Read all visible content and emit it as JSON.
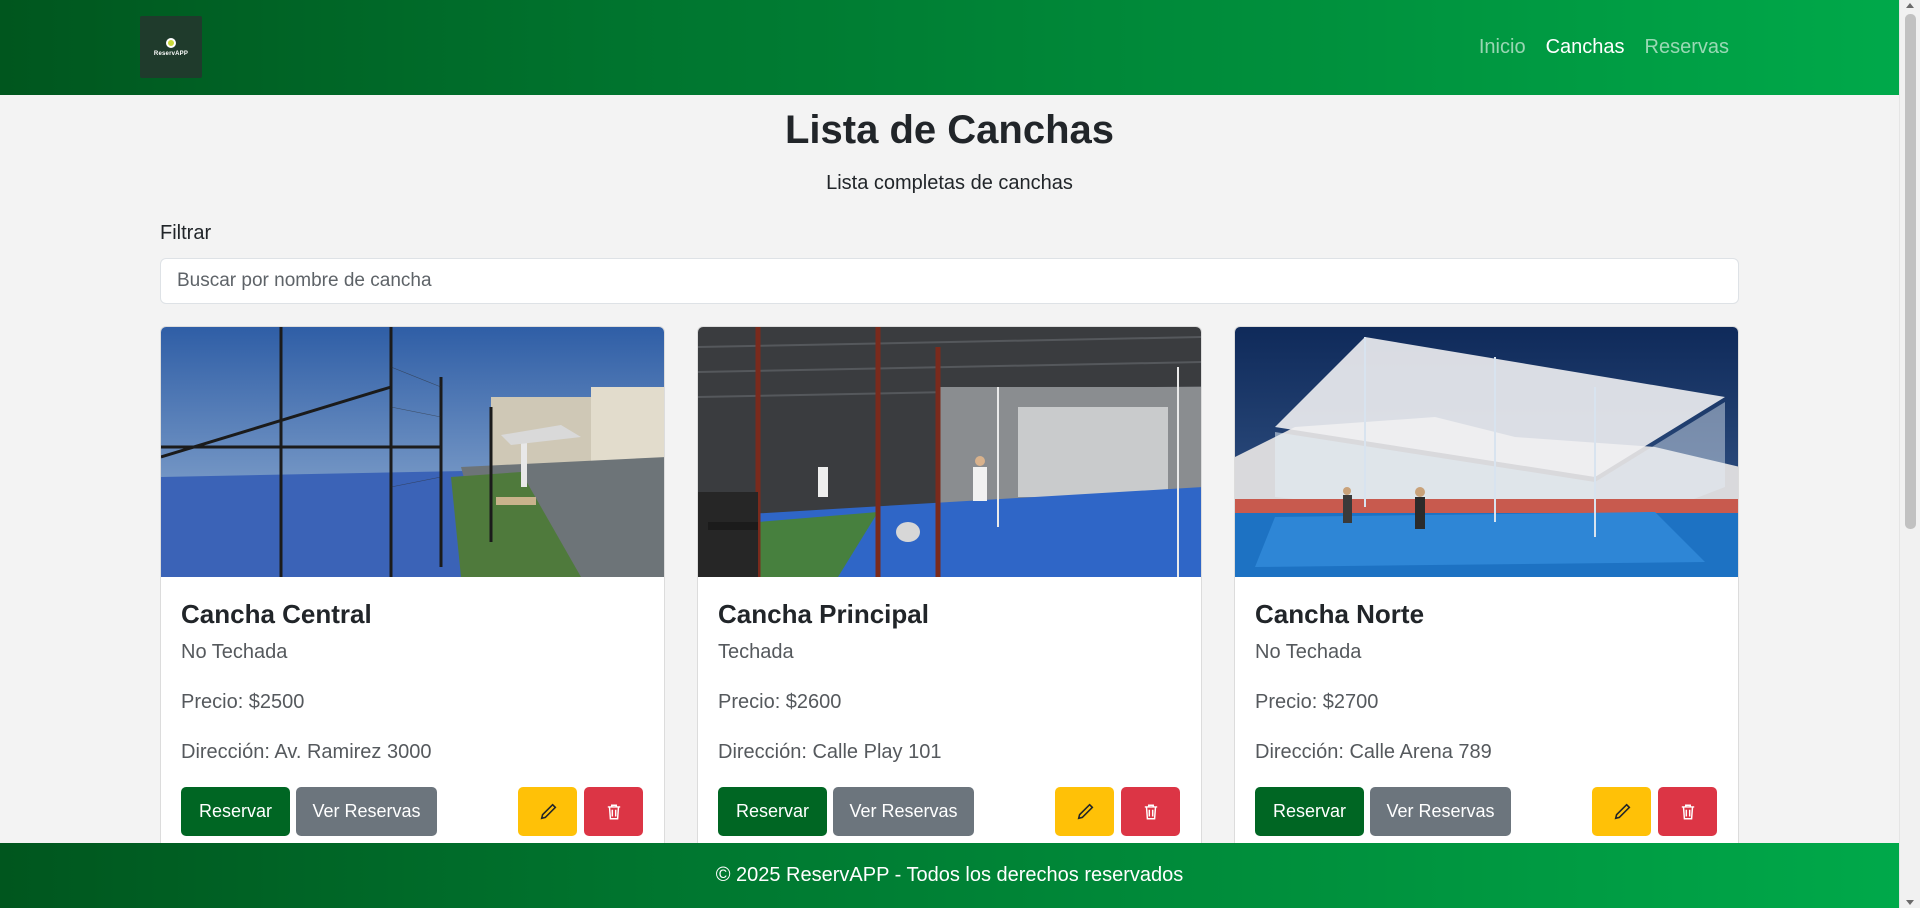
{
  "brand": {
    "logo_text": "ReservAPP"
  },
  "nav": {
    "items": [
      "Inicio",
      "Canchas",
      "Reservas"
    ],
    "active": "Canchas"
  },
  "page": {
    "title": "Lista de Canchas",
    "subtitle": "Lista completas de canchas"
  },
  "filter": {
    "label": "Filtrar",
    "placeholder": "Buscar por nombre de cancha",
    "value": ""
  },
  "canchas": [
    {
      "name": "Cancha Central",
      "tipo": "No Techada",
      "precio": "Precio: $2500",
      "direccion": "Dirección: Av. Ramirez 3000",
      "image": "outdoor-padel-court-photo"
    },
    {
      "name": "Cancha Principal",
      "tipo": "Techada",
      "precio": "Precio: $2600",
      "direccion": "Dirección: Calle Play 101",
      "image": "indoor-padel-court-photo"
    },
    {
      "name": "Cancha Norte",
      "tipo": "No Techada",
      "precio": "Precio: $2700",
      "direccion": "Dirección: Calle Arena 789",
      "image": "tournament-padel-court-photo"
    }
  ],
  "card_actions": {
    "reservar": "Reservar",
    "ver_reservas": "Ver Reservas",
    "edit_icon": "pencil-icon",
    "delete_icon": "trash-icon"
  },
  "footer": {
    "text": "© 2025 ReservAPP - Todos los derechos reservados"
  },
  "colors": {
    "brand_dark": "#00561e",
    "brand_light": "#00a94a",
    "primary_button": "#006623",
    "secondary_button": "#6c757d",
    "warning": "#ffc107",
    "danger": "#dc3545"
  }
}
